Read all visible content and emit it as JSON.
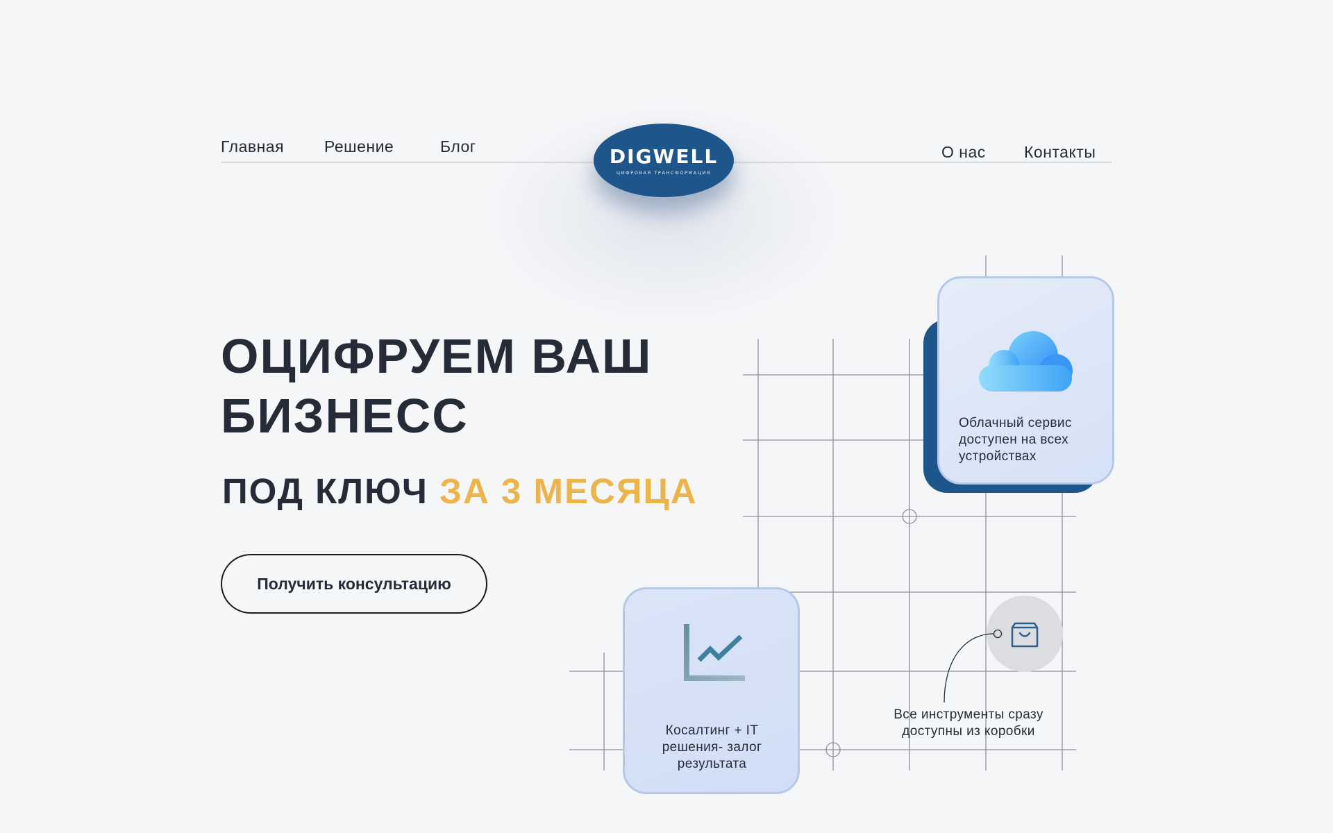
{
  "nav": {
    "left": [
      {
        "label": "Главная"
      },
      {
        "label": "Решение"
      },
      {
        "label": "Блог"
      }
    ],
    "right": [
      {
        "label": "О нас"
      },
      {
        "label": "Контакты"
      }
    ]
  },
  "logo": {
    "word": "DIGWELL",
    "tagline": "ЦИФРОВАЯ ТРАНСФОРМАЦИЯ"
  },
  "hero": {
    "title": "ОЦИФРУЕМ ВАШ БИЗНЕСС",
    "subtitle_plain": "ПОД КЛЮЧ ",
    "subtitle_accent": "ЗА 3 МЕСЯЦА",
    "cta_label": "Получить консультацию"
  },
  "features": {
    "cloud": "Облачный сервис доступен на всех устройствах",
    "consulting": "Косалтинг + IT решения- залог результата",
    "tools": "Все инструменты сразу доступны из коробки"
  },
  "icons": {
    "cloud": "cloud-icon",
    "chart": "chart-icon",
    "bag": "shopping-bag-icon"
  },
  "colors": {
    "background": "#f5f6f8",
    "brand_blue": "#1e558a",
    "accent_yellow": "#ebb54c",
    "text_dark": "#262b38",
    "card_border": "#b5c8e8"
  }
}
